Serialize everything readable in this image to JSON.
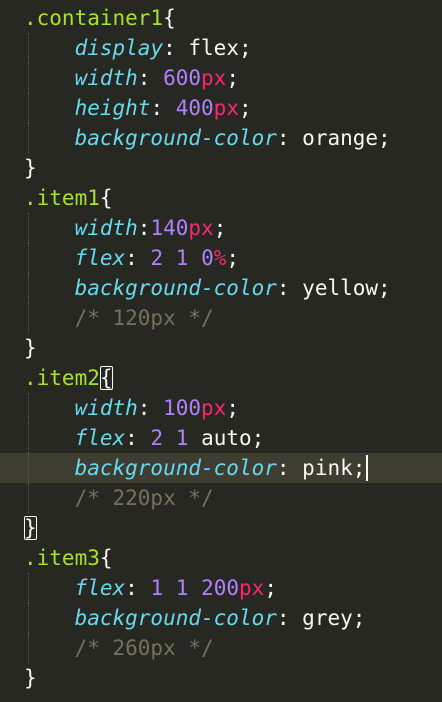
{
  "editor": {
    "theme": "monokai",
    "colors": {
      "background": "#272822",
      "active_line": "#3e3d32",
      "selector": "#a6e22e",
      "property": "#66d9ef",
      "number": "#ae81ff",
      "unit": "#f92672",
      "comment": "#75715e",
      "text": "#f8f8f2"
    },
    "active_line_number": 16,
    "cursor_line_number": 16,
    "lines": [
      {
        "tokens": [
          {
            "t": "sel",
            "v": ".container1"
          },
          {
            "t": "punc",
            "v": "{"
          }
        ]
      },
      {
        "indent": true,
        "tokens": [
          {
            "t": "prop",
            "v": "display"
          },
          {
            "t": "punc",
            "v": ": "
          },
          {
            "t": "val",
            "v": "flex"
          },
          {
            "t": "punc",
            "v": ";"
          }
        ]
      },
      {
        "indent": true,
        "tokens": [
          {
            "t": "prop",
            "v": "width"
          },
          {
            "t": "punc",
            "v": ": "
          },
          {
            "t": "num",
            "v": "600"
          },
          {
            "t": "unit",
            "v": "px"
          },
          {
            "t": "punc",
            "v": ";"
          }
        ]
      },
      {
        "indent": true,
        "tokens": [
          {
            "t": "prop",
            "v": "height"
          },
          {
            "t": "punc",
            "v": ": "
          },
          {
            "t": "num",
            "v": "400"
          },
          {
            "t": "unit",
            "v": "px"
          },
          {
            "t": "punc",
            "v": ";"
          }
        ]
      },
      {
        "indent": true,
        "tokens": [
          {
            "t": "prop",
            "v": "background-color"
          },
          {
            "t": "punc",
            "v": ": "
          },
          {
            "t": "val",
            "v": "orange"
          },
          {
            "t": "punc",
            "v": ";"
          }
        ]
      },
      {
        "tokens": [
          {
            "t": "punc",
            "v": "}"
          }
        ]
      },
      {
        "tokens": [
          {
            "t": "sel",
            "v": ".item1"
          },
          {
            "t": "punc",
            "v": "{"
          }
        ]
      },
      {
        "indent": true,
        "tokens": [
          {
            "t": "prop",
            "v": "width"
          },
          {
            "t": "punc",
            "v": ":"
          },
          {
            "t": "num",
            "v": "140"
          },
          {
            "t": "unit",
            "v": "px"
          },
          {
            "t": "punc",
            "v": ";"
          }
        ]
      },
      {
        "indent": true,
        "tokens": [
          {
            "t": "prop",
            "v": "flex"
          },
          {
            "t": "punc",
            "v": ": "
          },
          {
            "t": "num",
            "v": "2"
          },
          {
            "t": "punc",
            "v": " "
          },
          {
            "t": "num",
            "v": "1"
          },
          {
            "t": "punc",
            "v": " "
          },
          {
            "t": "num",
            "v": "0"
          },
          {
            "t": "unit",
            "v": "%"
          },
          {
            "t": "punc",
            "v": ";"
          }
        ]
      },
      {
        "indent": true,
        "tokens": [
          {
            "t": "prop",
            "v": "background-color"
          },
          {
            "t": "punc",
            "v": ": "
          },
          {
            "t": "val",
            "v": "yellow"
          },
          {
            "t": "punc",
            "v": ";"
          }
        ]
      },
      {
        "indent": true,
        "tokens": [
          {
            "t": "cmt",
            "v": "/* 120px */"
          }
        ]
      },
      {
        "tokens": [
          {
            "t": "punc",
            "v": "}"
          }
        ]
      },
      {
        "tokens": [
          {
            "t": "sel",
            "v": ".item2"
          },
          {
            "t": "bracket",
            "v": "{"
          }
        ]
      },
      {
        "indent": true,
        "tokens": [
          {
            "t": "prop",
            "v": "width"
          },
          {
            "t": "punc",
            "v": ": "
          },
          {
            "t": "num",
            "v": "100"
          },
          {
            "t": "unit",
            "v": "px"
          },
          {
            "t": "punc",
            "v": ";"
          }
        ]
      },
      {
        "indent": true,
        "tokens": [
          {
            "t": "prop",
            "v": "flex"
          },
          {
            "t": "punc",
            "v": ": "
          },
          {
            "t": "num",
            "v": "2"
          },
          {
            "t": "punc",
            "v": " "
          },
          {
            "t": "num",
            "v": "1"
          },
          {
            "t": "punc",
            "v": " "
          },
          {
            "t": "val",
            "v": "auto"
          },
          {
            "t": "punc",
            "v": ";"
          }
        ]
      },
      {
        "indent": true,
        "active": true,
        "caret": true,
        "tokens": [
          {
            "t": "prop",
            "v": "background-color"
          },
          {
            "t": "punc",
            "v": ": "
          },
          {
            "t": "val",
            "v": "pink"
          },
          {
            "t": "punc",
            "v": ";"
          }
        ]
      },
      {
        "indent": true,
        "tokens": [
          {
            "t": "cmt",
            "v": "/* 220px */"
          }
        ]
      },
      {
        "tokens": [
          {
            "t": "bracket",
            "v": "}"
          }
        ]
      },
      {
        "tokens": [
          {
            "t": "sel",
            "v": ".item3"
          },
          {
            "t": "punc",
            "v": "{"
          }
        ]
      },
      {
        "indent": true,
        "tokens": [
          {
            "t": "prop",
            "v": "flex"
          },
          {
            "t": "punc",
            "v": ": "
          },
          {
            "t": "num",
            "v": "1"
          },
          {
            "t": "punc",
            "v": " "
          },
          {
            "t": "num",
            "v": "1"
          },
          {
            "t": "punc",
            "v": " "
          },
          {
            "t": "num",
            "v": "200"
          },
          {
            "t": "unit",
            "v": "px"
          },
          {
            "t": "punc",
            "v": ";"
          }
        ]
      },
      {
        "indent": true,
        "tokens": [
          {
            "t": "prop",
            "v": "background-color"
          },
          {
            "t": "punc",
            "v": ": "
          },
          {
            "t": "val",
            "v": "grey"
          },
          {
            "t": "punc",
            "v": ";"
          }
        ]
      },
      {
        "indent": true,
        "tokens": [
          {
            "t": "cmt",
            "v": "/* 260px */"
          }
        ]
      },
      {
        "tokens": [
          {
            "t": "punc",
            "v": "}"
          }
        ]
      }
    ]
  }
}
